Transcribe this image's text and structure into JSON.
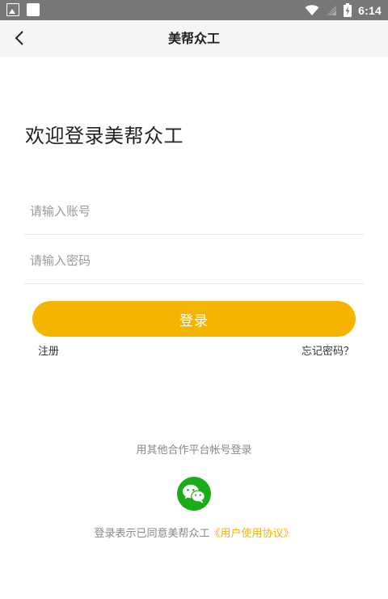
{
  "status_bar": {
    "time": "6:14",
    "icons": [
      "image-icon",
      "notification-square-icon",
      "wifi-icon",
      "signal-icon",
      "battery-icon"
    ]
  },
  "nav": {
    "title": "美帮众工",
    "back_icon": "chevron-left-icon"
  },
  "welcome_text": "欢迎登录美帮众工",
  "form": {
    "account_placeholder": "请输入账号",
    "account_value": "",
    "password_placeholder": "请输入密码",
    "password_value": ""
  },
  "login_button": "登录",
  "register_link": "注册",
  "forgot_link": "忘记密码？",
  "other_login_label": "用其他合作平台帐号登录",
  "third_party": {
    "icon": "wechat-icon",
    "color": "#1aad19"
  },
  "agreement": {
    "prefix": "登录表示已同意美帮众工",
    "link": "《用户使用协议》"
  },
  "colors": {
    "accent": "#f5b400",
    "status_bar": "#777777",
    "nav_bar": "#f5f5f5"
  }
}
